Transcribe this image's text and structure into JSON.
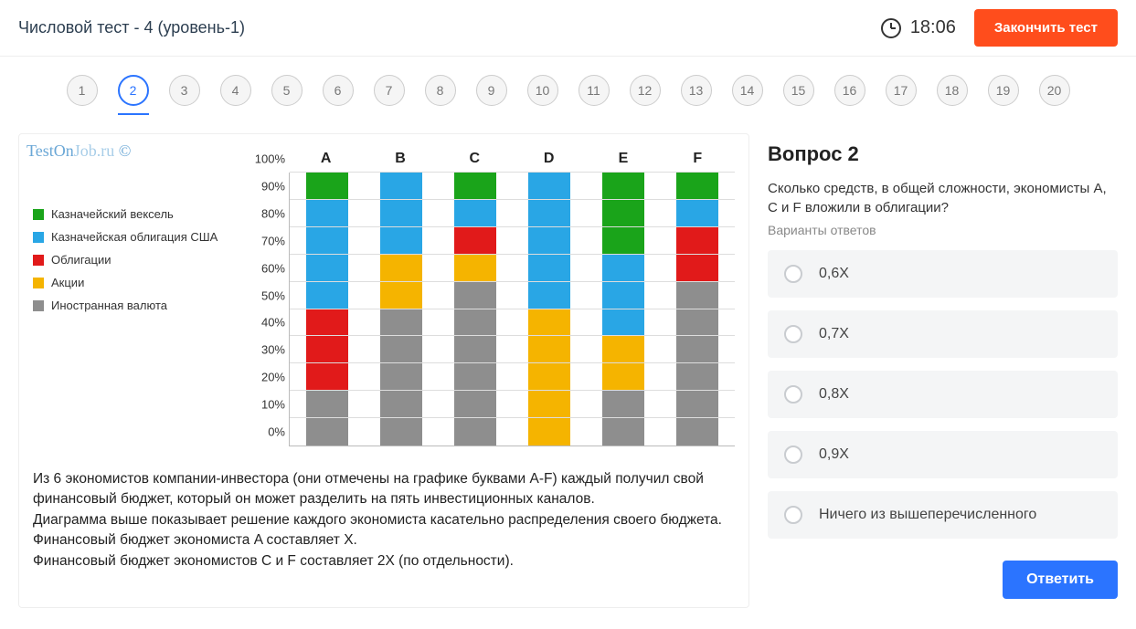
{
  "header": {
    "title": "Числовой тест - 4 (уровень-1)",
    "time": "18:06",
    "finish_label": "Закончить тест"
  },
  "qnav": {
    "items": [
      "1",
      "2",
      "3",
      "4",
      "5",
      "6",
      "7",
      "8",
      "9",
      "10",
      "11",
      "12",
      "13",
      "14",
      "15",
      "16",
      "17",
      "18",
      "19",
      "20"
    ],
    "active_index": 1
  },
  "watermark": {
    "a": "TestOn",
    "b": "Job.ru",
    "c": " ©"
  },
  "legend": [
    {
      "label": "Казначейский вексель",
      "color": "#1aa41a"
    },
    {
      "label": "Казначейская облигация США",
      "color": "#29a6e5"
    },
    {
      "label": "Облигации",
      "color": "#e11a1a"
    },
    {
      "label": "Акции",
      "color": "#f5b400"
    },
    {
      "label": "Иностранная валюта",
      "color": "#8e8e8e"
    }
  ],
  "chart_data": {
    "type": "bar",
    "stacked": true,
    "title": "",
    "xlabel": "",
    "ylabel": "",
    "ylim": [
      0,
      100
    ],
    "yticks": [
      0,
      10,
      20,
      30,
      40,
      50,
      60,
      70,
      80,
      90,
      100
    ],
    "ytick_labels": [
      "0%",
      "10%",
      "20%",
      "30%",
      "40%",
      "50%",
      "60%",
      "70%",
      "80%",
      "90%",
      "100%"
    ],
    "categories": [
      "A",
      "B",
      "C",
      "D",
      "E",
      "F"
    ],
    "series": [
      {
        "name": "Иностранная валюта",
        "color": "#8e8e8e",
        "values": [
          20,
          50,
          60,
          0,
          20,
          60
        ]
      },
      {
        "name": "Акции",
        "color": "#f5b400",
        "values": [
          0,
          20,
          10,
          50,
          20,
          0
        ]
      },
      {
        "name": "Облигации",
        "color": "#e11a1a",
        "values": [
          30,
          0,
          10,
          0,
          0,
          20
        ]
      },
      {
        "name": "Казначейская облигация США",
        "color": "#29a6e5",
        "values": [
          40,
          30,
          10,
          50,
          30,
          10
        ]
      },
      {
        "name": "Казначейский вексель",
        "color": "#1aa41a",
        "values": [
          10,
          0,
          10,
          0,
          30,
          10
        ]
      }
    ]
  },
  "description": [
    "Из 6 экономистов компании-инвестора (они отмечены на графике буквами A-F) каждый получил свой финансовый бюджет, который он может разделить на пять инвестиционных каналов.",
    "Диаграмма выше показывает решение каждого экономиста касательно распределения своего бюджета.",
    "Финансовый бюджет экономиста A составляет X.",
    "Финансовый бюджет экономистов C и F составляет 2X  (по отдельности)."
  ],
  "question": {
    "heading": "Вопрос 2",
    "text": "Сколько средств, в общей сложности, экономисты A, C и F вложили в облигации?",
    "options_label": "Варианты ответов",
    "options": [
      "0,6X",
      "0,7X",
      "0,8X",
      "0,9X",
      "Ничего из вышеперечисленного"
    ],
    "answer_label": "Ответить"
  }
}
